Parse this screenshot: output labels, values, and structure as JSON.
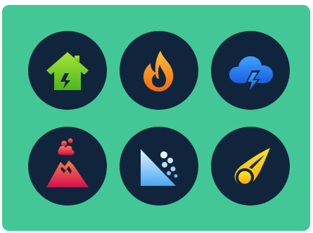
{
  "colors": {
    "panel_bg": "#43c796",
    "tile_bg": "#10253c"
  },
  "grid": {
    "tiles": [
      {
        "icon": "earthquake-house-icon",
        "colors": [
          "#a8e43a",
          "#4fb51c"
        ]
      },
      {
        "icon": "wildfire-flame-icon",
        "colors": [
          "#ffc03a",
          "#f26b10"
        ]
      },
      {
        "icon": "thunderstorm-cloud-icon",
        "colors": [
          "#3fa4ff",
          "#1a5fe0"
        ]
      },
      {
        "icon": "volcano-eruption-icon",
        "colors": [
          "#ff7a4a",
          "#d0114f"
        ]
      },
      {
        "icon": "landslide-icon",
        "colors": [
          "#e6f6ff",
          "#48a8f2"
        ]
      },
      {
        "icon": "meteor-impact-icon",
        "colors": [
          "#ffe028",
          "#f2b300"
        ]
      }
    ]
  }
}
